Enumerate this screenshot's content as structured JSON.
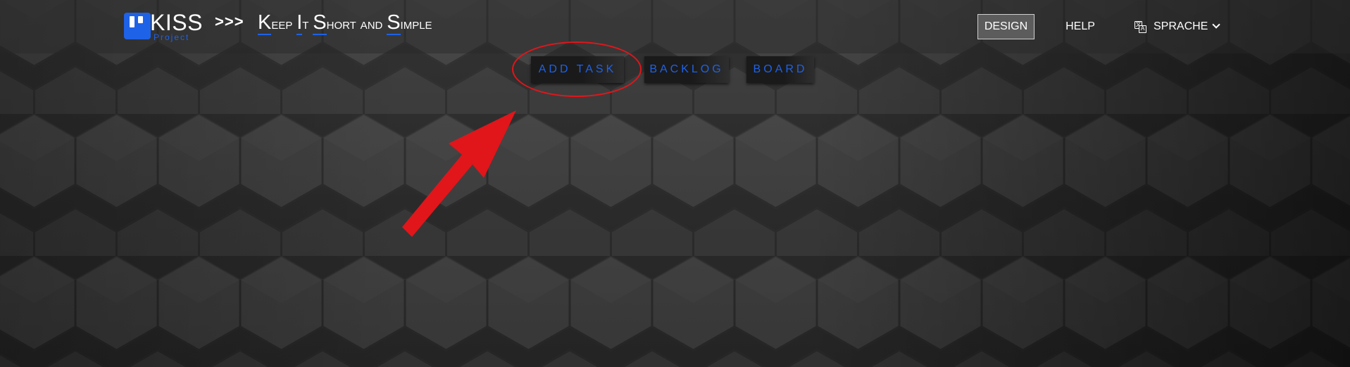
{
  "brand": {
    "logo_text": "KISS",
    "logo_subtext": "Project",
    "arrows": ">>>",
    "tagline": [
      {
        "cap": "K",
        "rest": "eep"
      },
      {
        "cap": "I",
        "rest": "t"
      },
      {
        "cap": "S",
        "rest": "hort and"
      },
      {
        "cap": "S",
        "rest": "imple"
      }
    ]
  },
  "nav": {
    "design": "DESIGN",
    "help": "HELP",
    "language": "SPRACHE",
    "language_icon": "translate-icon",
    "chevron_icon": "chevron-down-icon"
  },
  "tabs": {
    "add_task": "ADD TASK",
    "backlog": "BACKLOG",
    "board": "BOARD"
  },
  "colors": {
    "accent": "#1e62e8",
    "annotation": "#e0161b",
    "background": "#2a2a2a"
  },
  "annotations": {
    "highlight": "circle around ADD TASK",
    "pointer": "red arrow"
  }
}
